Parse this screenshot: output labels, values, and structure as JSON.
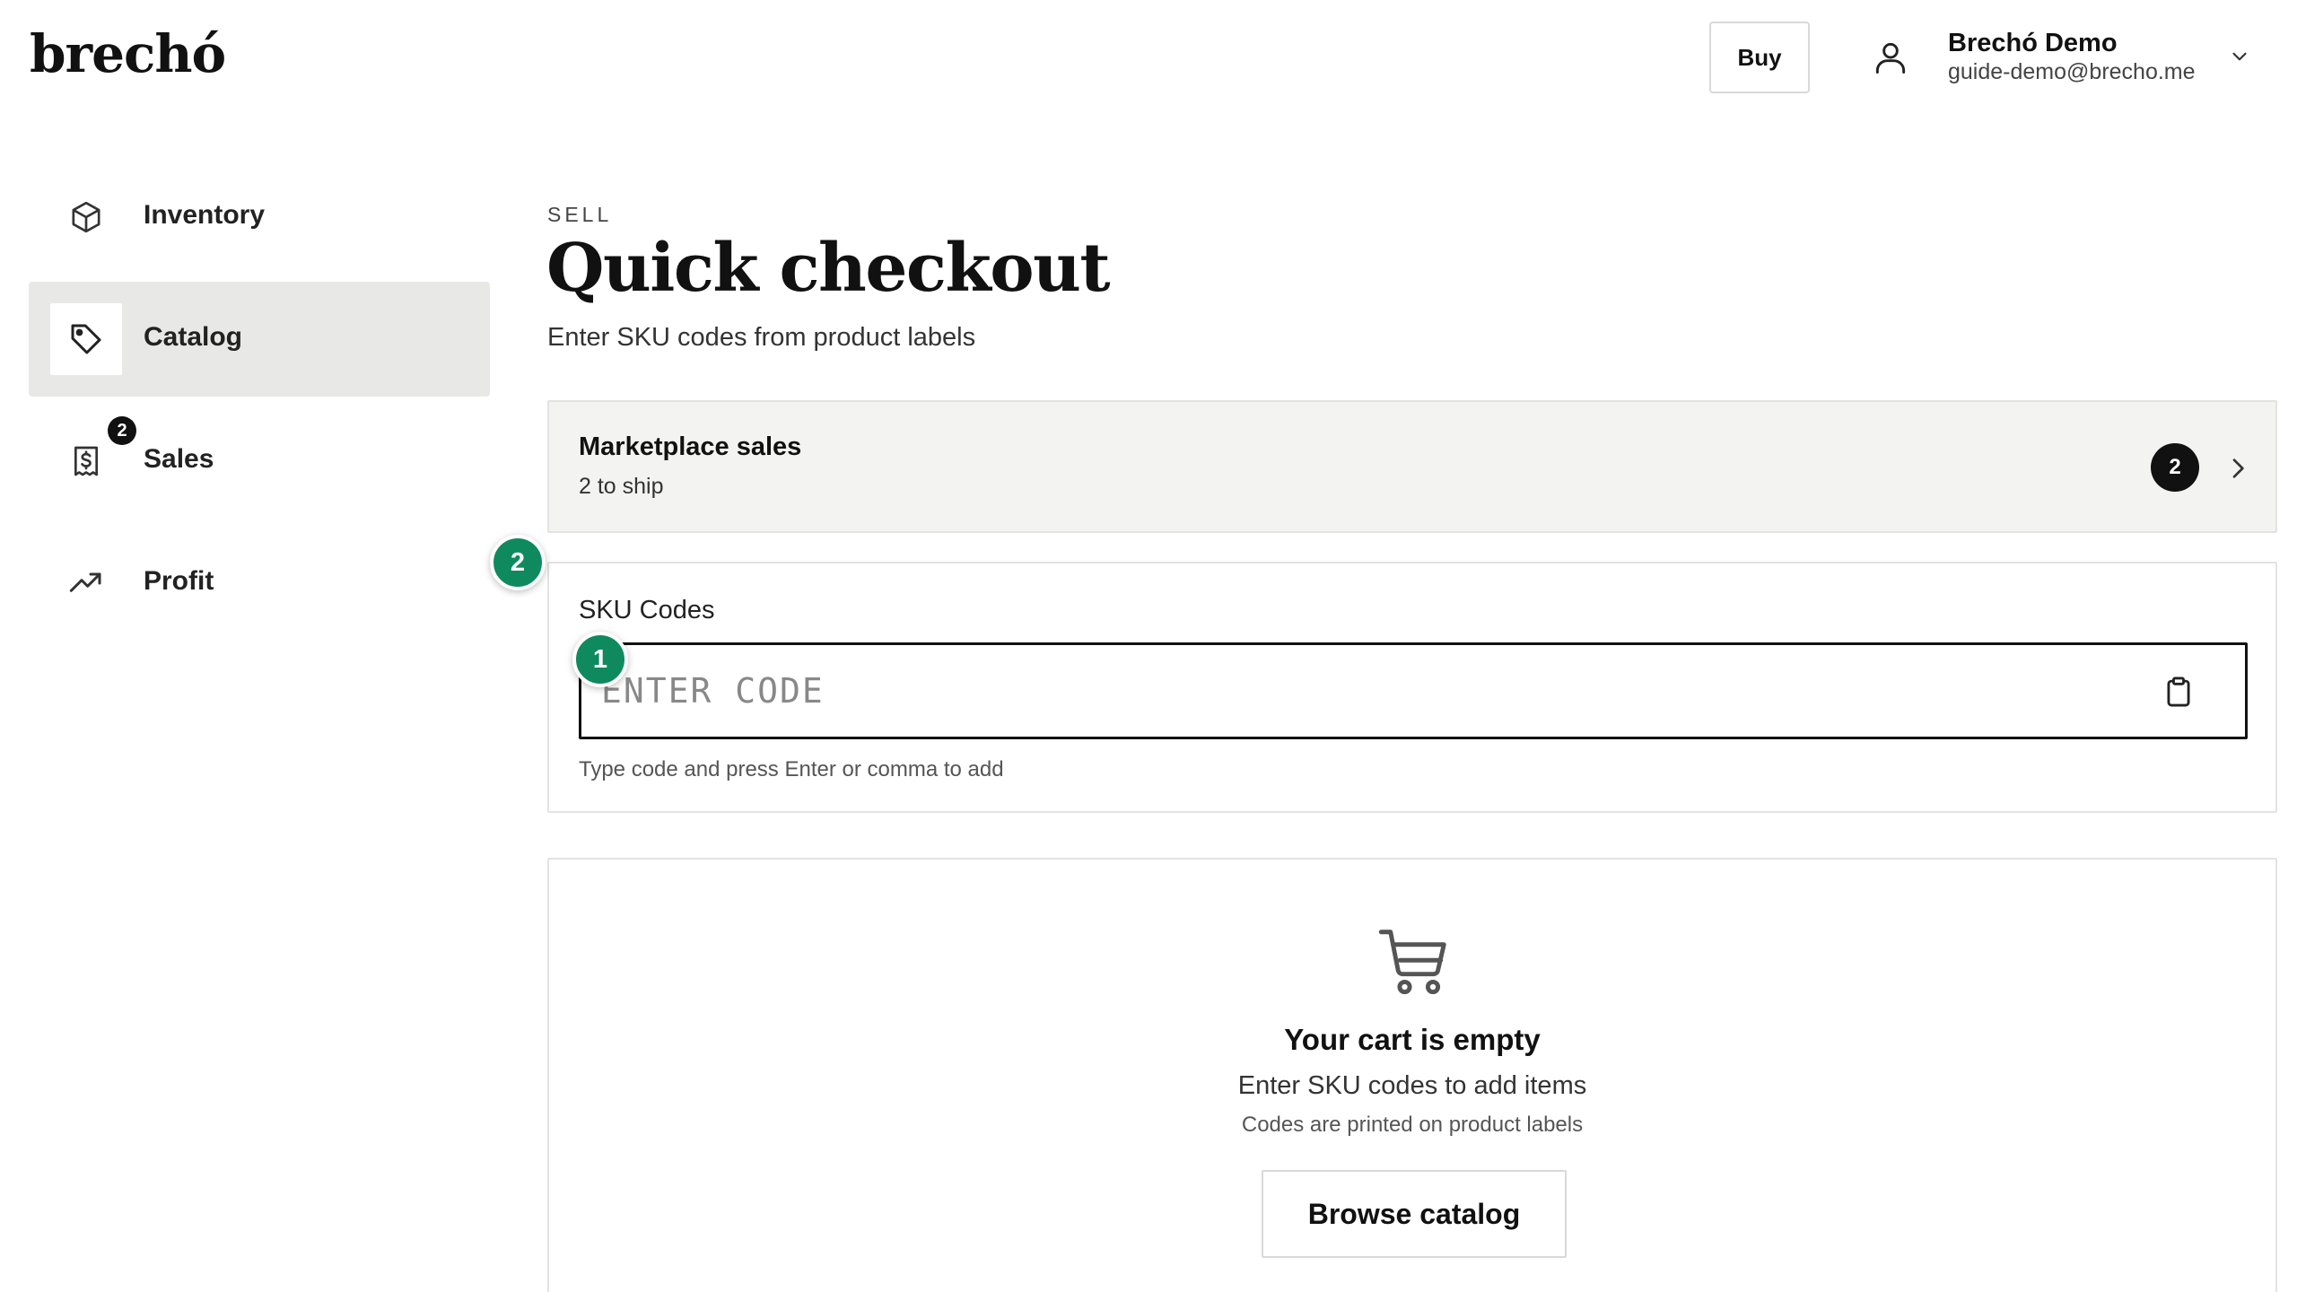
{
  "header": {
    "logo": "brechó",
    "buy_label": "Buy",
    "user": {
      "name": "Brechó Demo",
      "email": "guide-demo@brecho.me"
    }
  },
  "sidebar": {
    "items": [
      {
        "label": "Inventory",
        "icon": "box-icon",
        "active": false
      },
      {
        "label": "Catalog",
        "icon": "tag-icon",
        "active": true
      },
      {
        "label": "Sales",
        "icon": "receipt-dollar-icon",
        "active": false,
        "badge": "2"
      },
      {
        "label": "Profit",
        "icon": "trending-up-icon",
        "active": false
      }
    ]
  },
  "main": {
    "eyebrow": "SELL",
    "title": "Quick checkout",
    "subtitle": "Enter SKU codes from product labels",
    "marketplace": {
      "title": "Marketplace sales",
      "subtitle": "2 to ship",
      "count": "2"
    },
    "sku": {
      "label": "SKU Codes",
      "placeholder": "ENTER CODE",
      "value": "",
      "help": "Type code and press Enter or comma to add"
    },
    "cart": {
      "title": "Your cart is empty",
      "subtitle": "Enter SKU codes to add items",
      "note": "Codes are printed on product labels",
      "browse_label": "Browse catalog"
    }
  },
  "steps": [
    {
      "number": "1"
    },
    {
      "number": "2"
    }
  ],
  "colors": {
    "accent": "#0f8a5f",
    "active_nav_bg": "#e8e8e6",
    "card_bg": "#f3f3f1"
  }
}
